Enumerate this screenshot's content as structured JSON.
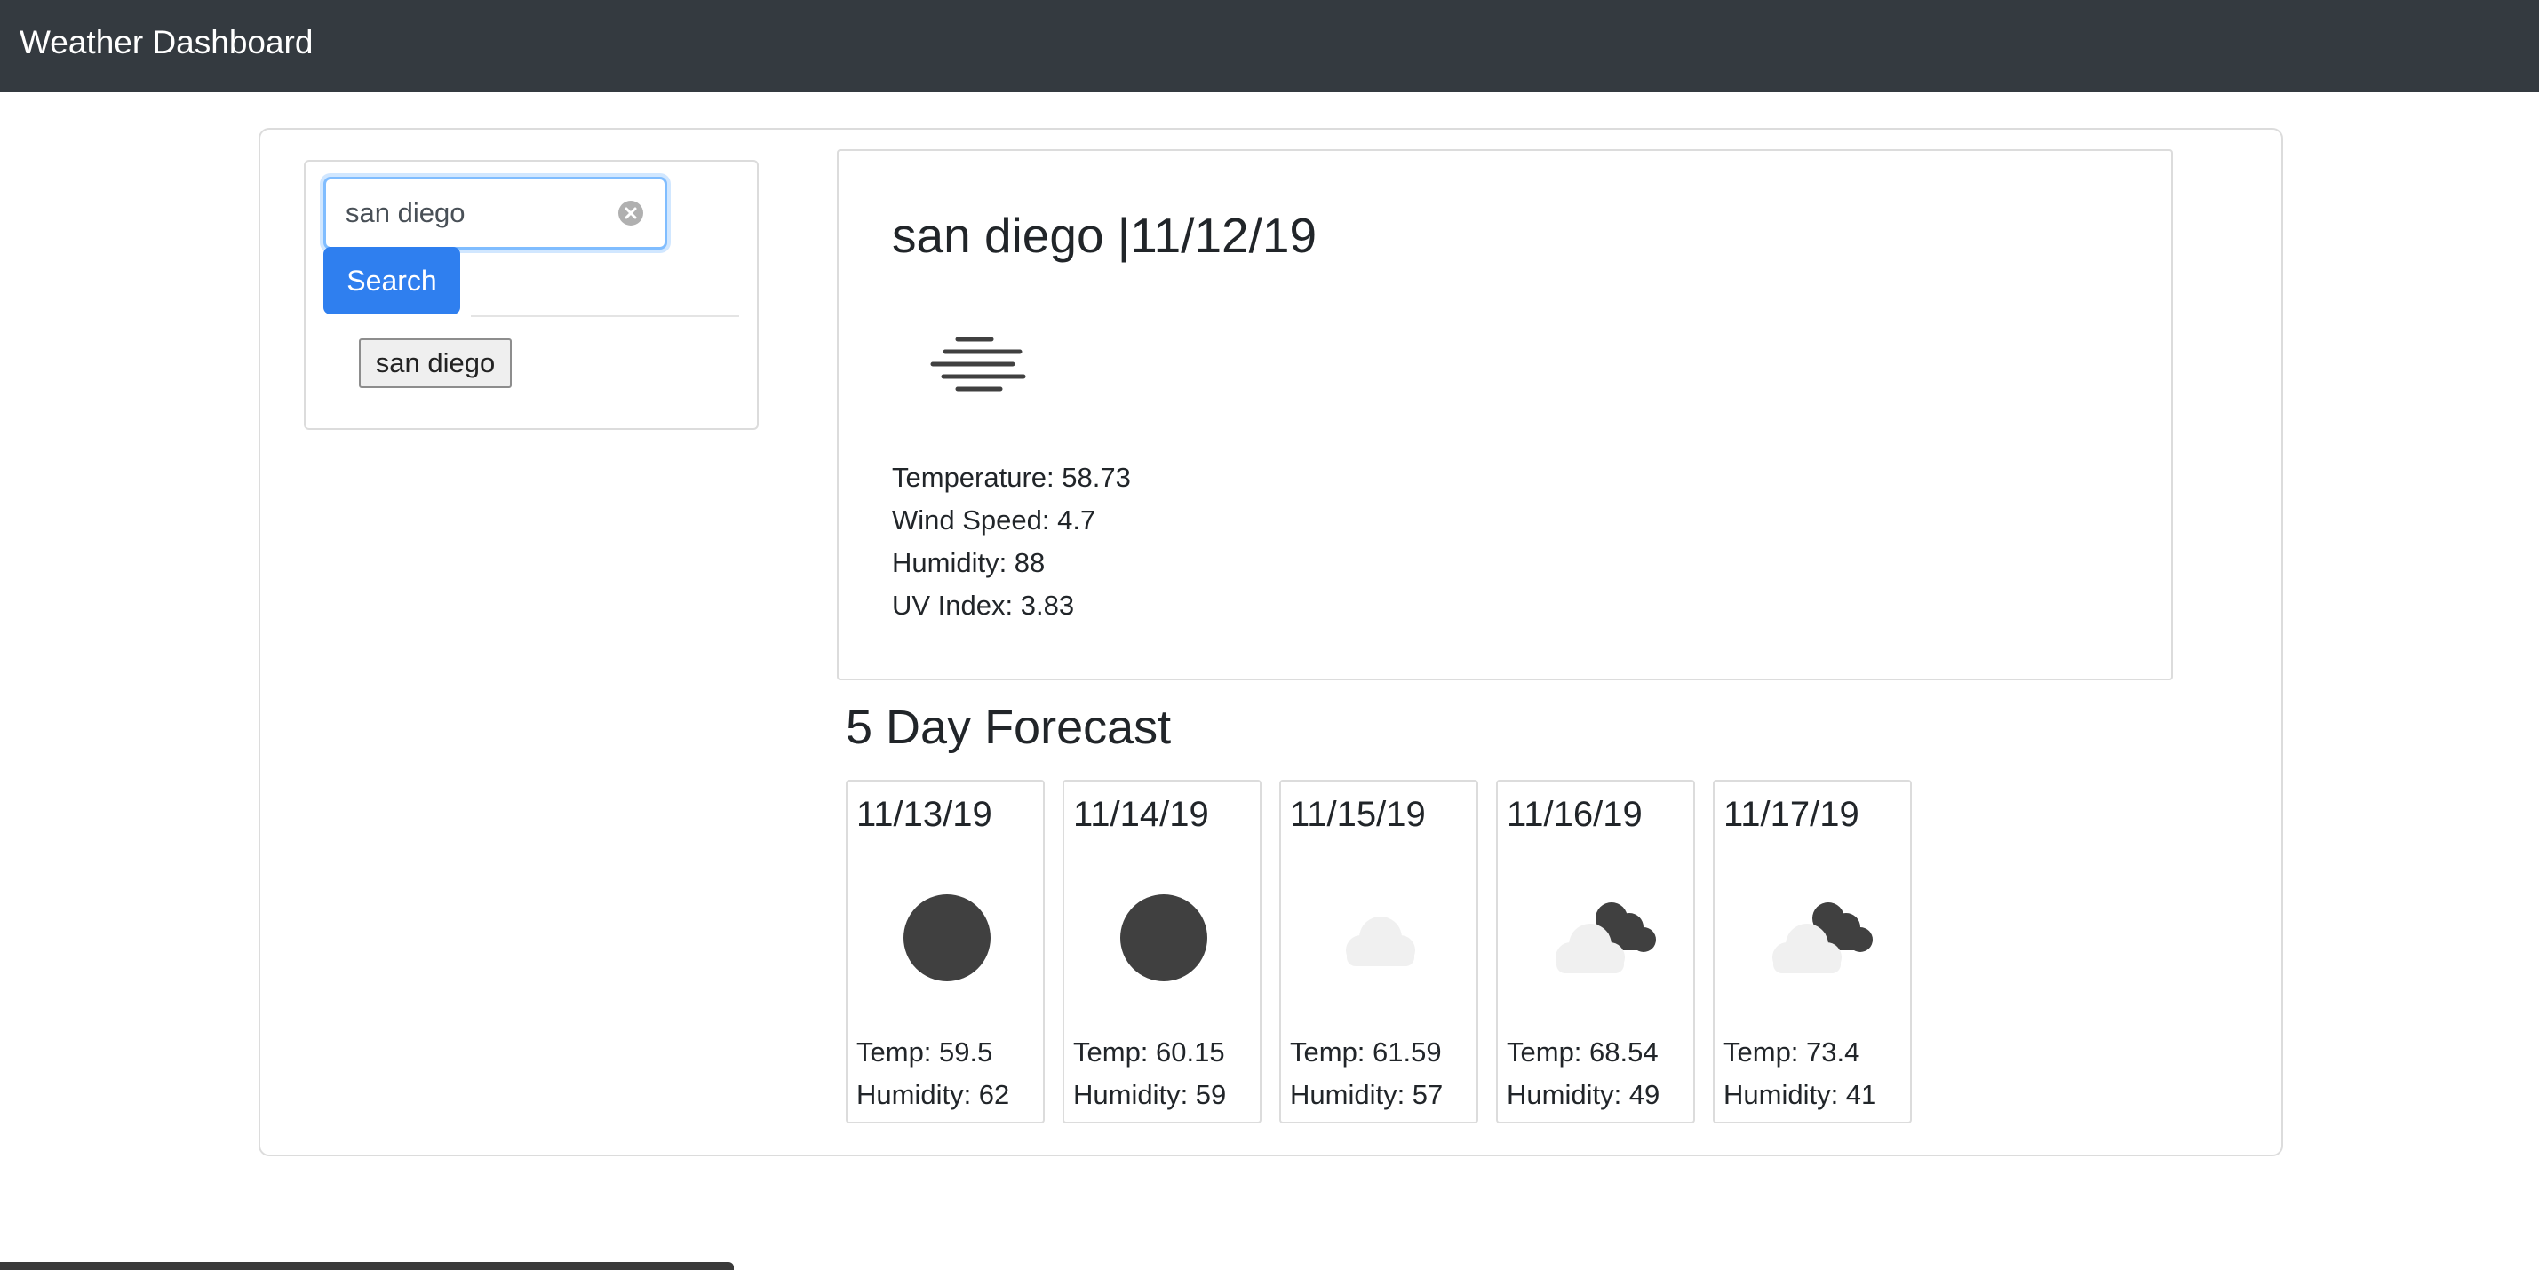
{
  "navbar": {
    "brand": "Weather Dashboard"
  },
  "search": {
    "input_value": "san diego",
    "button_label": "Search",
    "history": [
      "san diego"
    ]
  },
  "current": {
    "title": "san diego |11/12/19",
    "icon": "mist-icon",
    "temperature": "Temperature: 58.73",
    "wind_speed": "Wind Speed: 4.7",
    "humidity": "Humidity: 88",
    "uv_index": "UV Index: 3.83"
  },
  "forecast": {
    "title": "5 Day Forecast",
    "days": [
      {
        "date": "11/13/19",
        "icon": "clear-night-icon",
        "temp": "Temp: 59.5",
        "humidity": "Humidity: 62"
      },
      {
        "date": "11/14/19",
        "icon": "clear-night-icon",
        "temp": "Temp: 60.15",
        "humidity": "Humidity: 59"
      },
      {
        "date": "11/15/19",
        "icon": "cloud-icon",
        "temp": "Temp: 61.59",
        "humidity": "Humidity: 57"
      },
      {
        "date": "11/16/19",
        "icon": "broken-clouds-icon",
        "temp": "Temp: 68.54",
        "humidity": "Humidity: 49"
      },
      {
        "date": "11/17/19",
        "icon": "broken-clouds-icon",
        "temp": "Temp: 73.4",
        "humidity": "Humidity: 41"
      }
    ]
  },
  "colors": {
    "navbar_bg": "#343a40",
    "primary_button": "#2f7fef",
    "focus_border": "#80bdff",
    "icon_dark": "#404040",
    "icon_light": "#f0f0f0"
  }
}
